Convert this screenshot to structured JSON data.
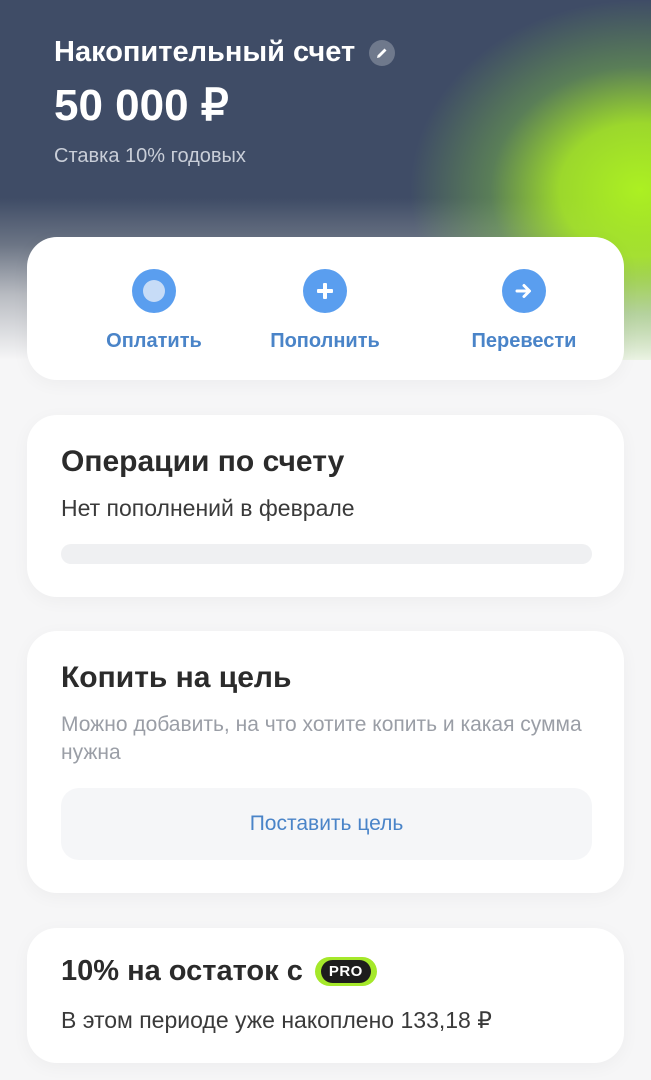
{
  "header": {
    "title": "Накопительный счет",
    "balance": "50 000 ₽",
    "rate": "Ставка 10% годовых",
    "edit_icon": "pencil-icon"
  },
  "actions": [
    {
      "label": "Оплатить",
      "icon": "circle-icon"
    },
    {
      "label": "Пополнить",
      "icon": "plus-icon"
    },
    {
      "label": "Перевести",
      "icon": "arrow-right-icon"
    }
  ],
  "operations": {
    "title": "Операции по счету",
    "subtitle": "Нет пополнений в феврале"
  },
  "goal": {
    "title": "Копить на цель",
    "description": "Можно добавить, на что хотите копить и какая сумма нужна",
    "button_label": "Поставить цель"
  },
  "interest": {
    "title": "10% на остаток с",
    "badge": "PRO",
    "subtitle": "В этом периоде уже накоплено 133,18 ₽"
  },
  "colors": {
    "accent": "#4a84c8",
    "icon_blue": "#5a9eef",
    "header_bg": "#3f4c66",
    "lime": "#a5e82a"
  }
}
